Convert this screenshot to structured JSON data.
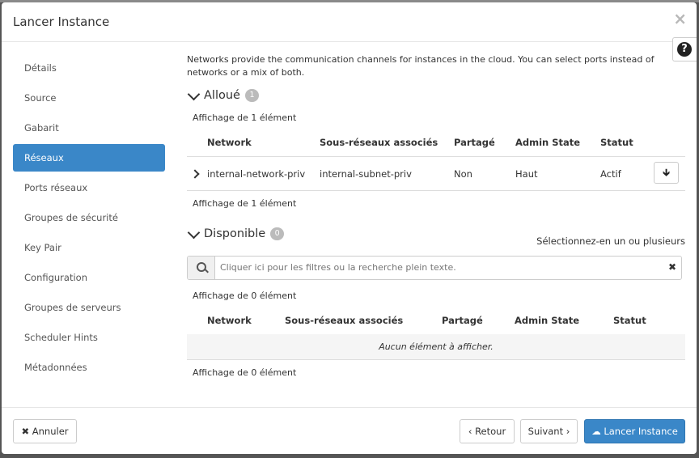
{
  "modal": {
    "title": "Lancer Instance",
    "close_glyph": "×",
    "help_glyph": "?"
  },
  "sidebar": {
    "items": [
      {
        "label": "Détails",
        "active": false
      },
      {
        "label": "Source",
        "active": false
      },
      {
        "label": "Gabarit",
        "active": false
      },
      {
        "label": "Réseaux",
        "active": true
      },
      {
        "label": "Ports réseaux",
        "active": false
      },
      {
        "label": "Groupes de sécurité",
        "active": false
      },
      {
        "label": "Key Pair",
        "active": false
      },
      {
        "label": "Configuration",
        "active": false
      },
      {
        "label": "Groupes de serveurs",
        "active": false
      },
      {
        "label": "Scheduler Hints",
        "active": false
      },
      {
        "label": "Métadonnées",
        "active": false
      }
    ]
  },
  "main": {
    "intro": "Networks provide the communication channels for instances in the cloud. You can select ports instead of networks or a mix of both.",
    "allocated": {
      "title": "Alloué",
      "badge": "1",
      "count_top": "Affichage de 1 élément",
      "count_bottom": "Affichage de 1 élément",
      "columns": [
        "Network",
        "Sous-réseaux associés",
        "Partagé",
        "Admin State",
        "Statut"
      ],
      "rows": [
        {
          "network": "internal-network-priv",
          "subnets": "internal-subnet-priv",
          "shared": "Non",
          "admin_state": "Haut",
          "status": "Actif"
        }
      ]
    },
    "available": {
      "title": "Disponible",
      "badge": "0",
      "select_hint": "Sélectionnez-en un ou plusieurs",
      "search_placeholder": "Cliquer ici pour les filtres ou la recherche plein texte.",
      "clear_glyph": "✖",
      "count_top": "Affichage de 0 élément",
      "count_bottom": "Affichage de 0 élément",
      "columns": [
        "Network",
        "Sous-réseaux associés",
        "Partagé",
        "Admin State",
        "Statut"
      ],
      "empty_text": "Aucun élément à afficher."
    }
  },
  "footer": {
    "cancel": "✖ Annuler",
    "back": "‹ Retour",
    "next": "Suivant ›",
    "launch": "☁ Lancer Instance"
  },
  "colors": {
    "primary": "#3a87c8",
    "badge": "#bbbbbb"
  }
}
